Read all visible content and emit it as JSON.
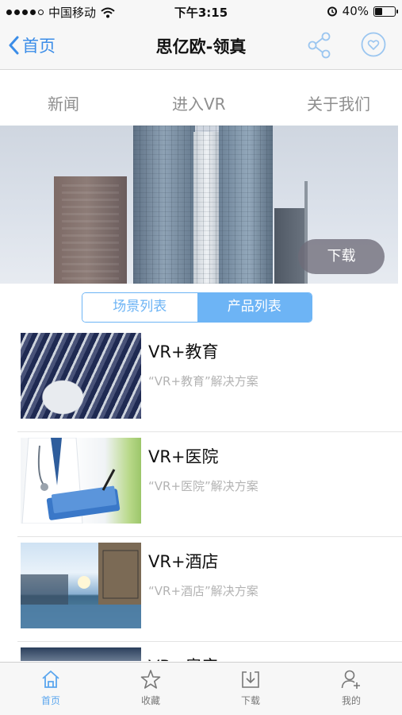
{
  "status_bar": {
    "carrier": "中国移动",
    "time": "下午3:15",
    "battery": "40%",
    "battery_level": 0.4
  },
  "nav": {
    "back_label": "首页",
    "title": "思亿欧-领真"
  },
  "top_tabs": [
    {
      "label": "新闻"
    },
    {
      "label": "进入VR"
    },
    {
      "label": "关于我们"
    }
  ],
  "banner": {
    "download_label": "下载"
  },
  "segmented": {
    "scenes_label": "场景列表",
    "products_label": "产品列表",
    "selected": "产品列表"
  },
  "products": [
    {
      "title": "VR+教育",
      "subtitle": "“VR+教育”解决方案"
    },
    {
      "title": "VR+医院",
      "subtitle": "“VR+医院”解决方案"
    },
    {
      "title": "VR+酒店",
      "subtitle": "“VR+酒店”解决方案"
    },
    {
      "title": "VR+房产",
      "subtitle": ""
    }
  ],
  "tab_bar": [
    {
      "label": "首页",
      "icon": "home-icon",
      "active": true
    },
    {
      "label": "收藏",
      "icon": "star-icon",
      "active": false
    },
    {
      "label": "下载",
      "icon": "download-icon",
      "active": false
    },
    {
      "label": "我的",
      "icon": "user-icon",
      "active": false
    }
  ],
  "colors": {
    "accent": "#3b8de8",
    "segment": "#6db4f5",
    "tab_active": "#5ba6ee"
  }
}
